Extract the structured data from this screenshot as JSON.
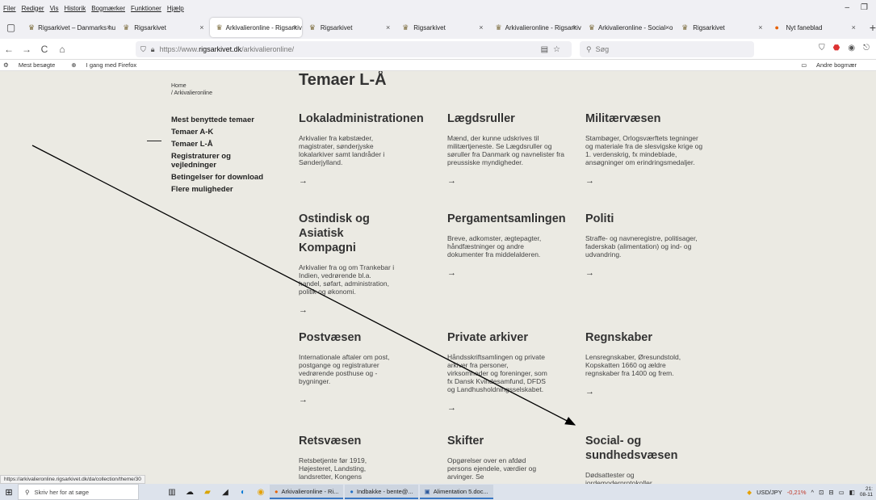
{
  "menubar": {
    "items": [
      "Filer",
      "Rediger",
      "Vis",
      "Historik",
      "Bogmærker",
      "Funktioner",
      "Hjælp"
    ]
  },
  "window_controls": {
    "minimize": "–",
    "maximize": "❐"
  },
  "tabs": [
    {
      "title": "Rigsarkivet – Danmarks hu",
      "close": "×"
    },
    {
      "title": "Rigsarkivet",
      "close": "×"
    },
    {
      "title": "Arkivalieronline - Rigsarkiv",
      "close": "×",
      "active": true
    },
    {
      "title": "Rigsarkivet",
      "close": "×"
    },
    {
      "title": "Rigsarkivet",
      "close": "×"
    },
    {
      "title": "Arkivalieronline - Rigsarkiv",
      "close": "×"
    },
    {
      "title": "Arkivalieronline - Social- o",
      "close": "×"
    },
    {
      "title": "Rigsarkivet",
      "close": "×"
    },
    {
      "title": "Nyt faneblad",
      "close": "×"
    }
  ],
  "new_tab": "+",
  "nav": {
    "back": "←",
    "forward": "→",
    "reload": "C",
    "home": "⌂",
    "url_prefix": "https://www.",
    "url_host": "rigsarkivet.dk",
    "url_path": "/arkivalieronline/",
    "search_placeholder": "Søg"
  },
  "bookmarks": {
    "most_visited": "Mest besøgte",
    "getting_started": "I gang med Firefox",
    "other": "Andre bogmær"
  },
  "page": {
    "breadcrumb_home": "Home",
    "breadcrumb_current": "/ Arkivalieronline",
    "title": "Temaer L-Å",
    "sidenav": [
      "Mest benyttede temaer",
      "Temaer A-K",
      "Temaer L-Å",
      "Registraturer og vejledninger",
      "Betingelser for download",
      "Flere muligheder"
    ],
    "cards": [
      {
        "title": "Lokaladministrationen",
        "text": "Arkivalier fra købstæder, magistrater, sønderjyske lokalarkiver samt landråder i Sønderjylland.",
        "arrow": "→"
      },
      {
        "title": "Lægdsruller",
        "text": "Mænd, der kunne udskrives til militærtjeneste. Se Lægdsruller og søruller fra Danmark og navnelister fra preussiske myndigheder.",
        "arrow": "→"
      },
      {
        "title": "Militærvæsen",
        "text": "Stambøger, Orlogsværftets tegninger og materiale fra de slesvigske krige og 1. verdenskrig, fx mindeblade, ansøgninger om erindringsmedaljer.",
        "arrow": "→"
      },
      {
        "title": "Ostindisk og Asiatisk Kompagni",
        "text": "Arkivalier fra og om Trankebar i Indien, vedrørende bl.a. handel, søfart, administration, politik og økonomi.",
        "arrow": "→"
      },
      {
        "title": "Pergamentsamlingen",
        "text": "Breve, adkomster, ægtepagter, håndfæstninger og andre dokumenter fra middelalderen.",
        "arrow": "→"
      },
      {
        "title": "Politi",
        "text": "Straffe- og navneregistre, politisager, faderskab (alimentation) og ind- og udvandring.",
        "arrow": "→"
      },
      {
        "title": "Postvæsen",
        "text": "Internationale aftaler om post, postgange og registraturer vedrørende posthuse og -bygninger.",
        "arrow": "→"
      },
      {
        "title": "Private arkiver",
        "text": "Håndsskriftsamlingen og private arkiver fra personer, virksomheder og foreninger, som fx Dansk Kvindesamfund, DFDS og Landhusholdningsselskabet.",
        "arrow": "→"
      },
      {
        "title": "Regnskaber",
        "text": "Lensregnskaber, Øresundstold, Kopskatten 1660 og ældre regnskaber fra 1400 og frem.",
        "arrow": "→"
      },
      {
        "title": "Retsvæsen",
        "text": "Retsbetjente før 1919, Højesteret, Landsting, landsretter, Kongens",
        "arrow": ""
      },
      {
        "title": "Skifter",
        "text": "Opgørelser over en afdød persons ejendele, værdier og arvinger. Se",
        "arrow": ""
      },
      {
        "title": "Social- og sundhedsvæsen",
        "text": "Dødsattester og jordemoderprotokoller.",
        "arrow": ""
      }
    ]
  },
  "status_url": "https://arkivalieronline.rigsarkivet.dk/da/collection/theme/30",
  "taskbar": {
    "search_placeholder": "Skriv her for at søge",
    "apps": [
      "Arkivalieronline - Ri...",
      "Indbakke - bente@...",
      "Alimentation 5.doc..."
    ],
    "currency": "USD/JPY",
    "currency_change": "-0,21%",
    "time": "21:",
    "date": "08-11"
  },
  "colors": {
    "page_bg": "#ebeae3",
    "arrow_line": "#000000",
    "negative": "#c0392b"
  }
}
